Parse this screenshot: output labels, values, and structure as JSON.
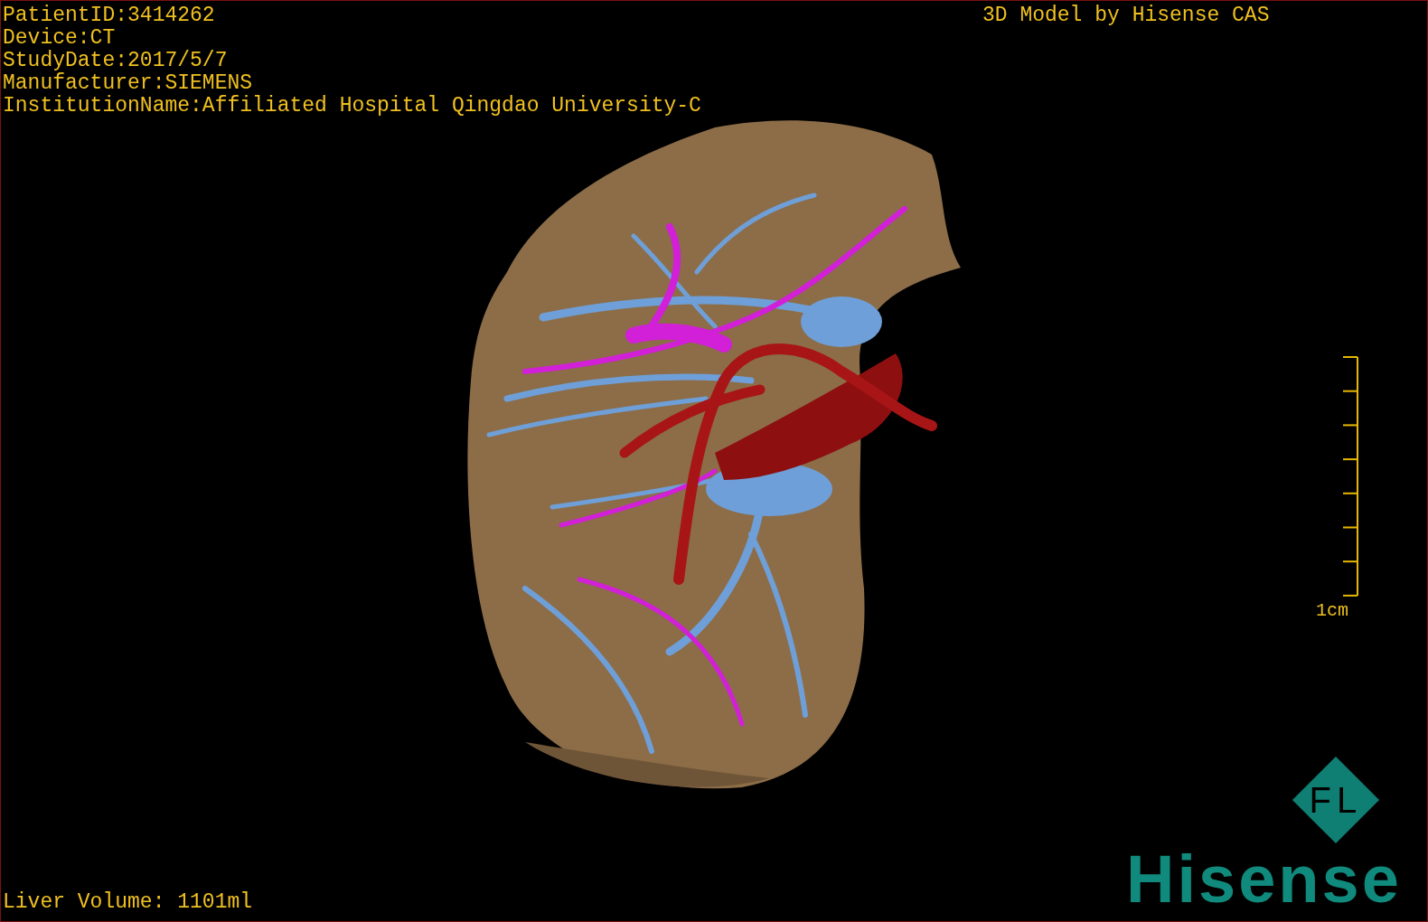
{
  "info_lines": [
    "PatientID:3414262",
    "Device:CT",
    "StudyDate:2017/5/7",
    "Manufacturer:SIEMENS",
    "InstitutionName:Affiliated Hospital Qingdao University-C"
  ],
  "model_title": "3D Model by Hisense CAS",
  "scale_bar": {
    "label": "1cm"
  },
  "volume": "Liver Volume: 1101ml",
  "logo": {
    "badge": "FL",
    "name": "Hisense"
  }
}
